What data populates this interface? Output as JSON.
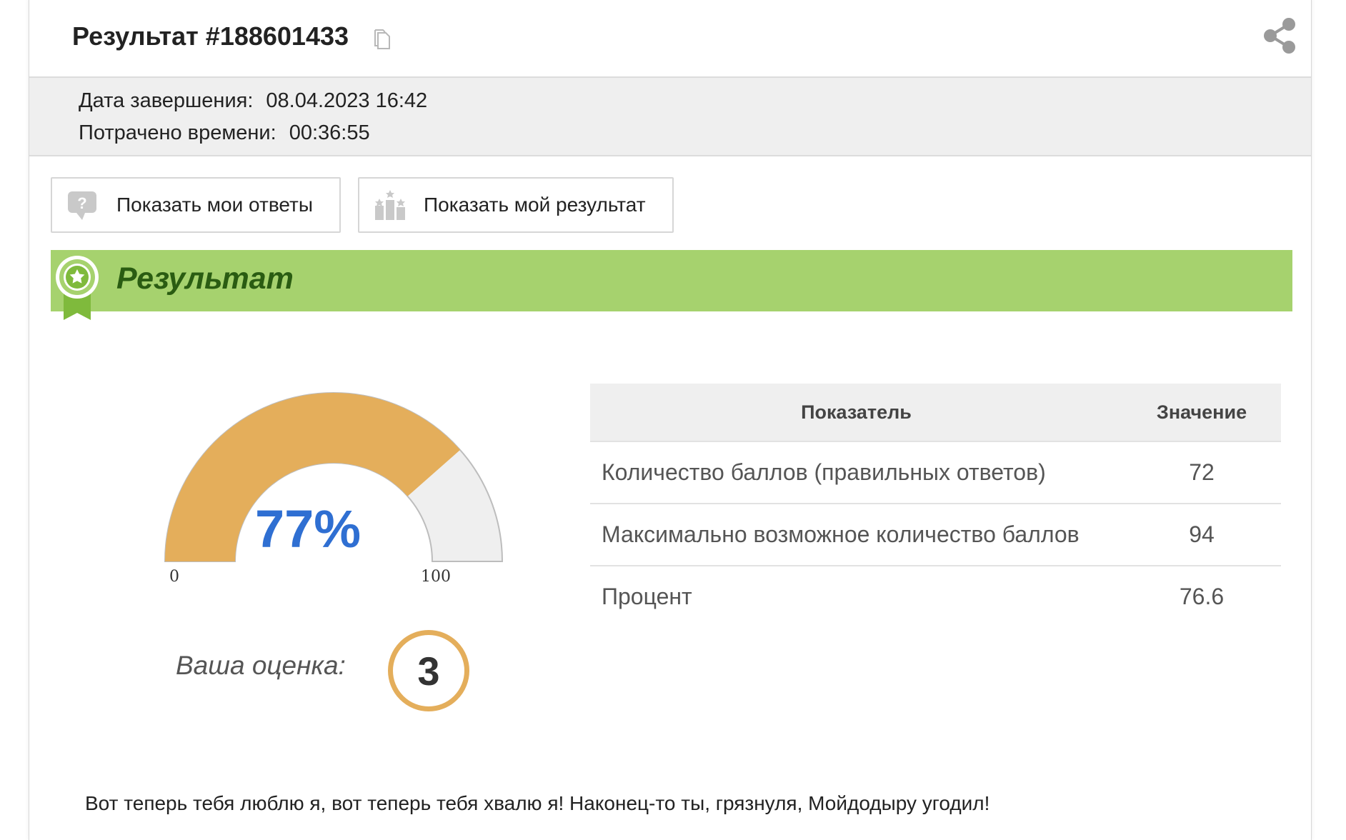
{
  "header": {
    "title": "Результат #188601433",
    "copy_icon": "copy-icon",
    "share_icon": "share-icon"
  },
  "meta": {
    "completion_label": "Дата завершения:",
    "completion_value": "08.04.2023 16:42",
    "time_label": "Потрачено времени:",
    "time_value": "00:36:55"
  },
  "buttons": {
    "answers_label": "Показать мои ответы",
    "answers_icon": "question-bubble-icon",
    "result_label": "Показать мой результат",
    "result_icon": "podium-icon"
  },
  "banner": {
    "label": "Результат",
    "icon": "award-ribbon-icon",
    "color": "#a6d26e"
  },
  "gauge": {
    "percent_label": "77%",
    "value": 77,
    "min_label": "0",
    "max_label": "100",
    "fill_color": "#e4ae5b",
    "empty_color": "#efefef",
    "text_color": "#2f6fd2"
  },
  "grade": {
    "label": "Ваша оценка:",
    "value": "3"
  },
  "stats": {
    "header_name": "Показатель",
    "header_value": "Значение",
    "rows": [
      {
        "name": "Количество баллов (правильных ответов)",
        "value": "72"
      },
      {
        "name": "Максимально возможное количество баллов",
        "value": "94"
      },
      {
        "name": "Процент",
        "value": "76.6"
      }
    ]
  },
  "footer": {
    "text": "Вот теперь тебя люблю я, вот теперь тебя хвалю я! Наконец-то ты, грязнуля, Мойдодыру угодил!"
  }
}
